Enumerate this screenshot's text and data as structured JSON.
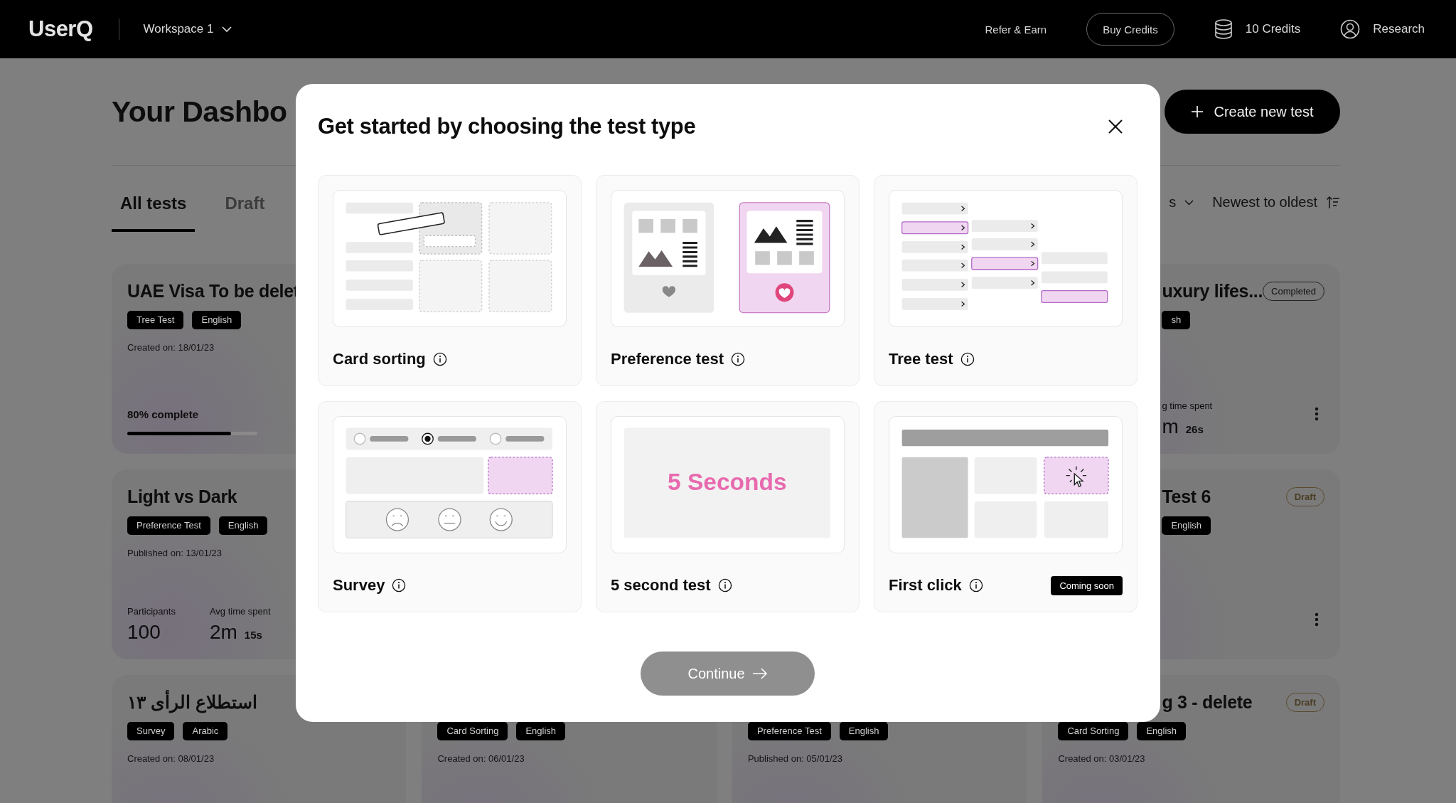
{
  "topbar": {
    "logo": "UserQ",
    "workspace": "Workspace 1",
    "refer": "Refer & Earn",
    "buy_credits": "Buy Credits",
    "credits": "10 Credits",
    "account": "Research"
  },
  "dashboard": {
    "title": "Your Dashbo",
    "create_button": "Create new test",
    "tabs": [
      {
        "label": "All tests",
        "selected": true
      },
      {
        "label": "Draft",
        "selected": false
      }
    ],
    "filter": "s",
    "sort": "Newest to oldest",
    "columns": [
      {
        "cards": [
          {
            "title": "UAE Visa To be delet",
            "tags": [
              "Tree Test",
              "English"
            ],
            "date": "Created on: 18/01/23",
            "progress_label": "80% complete",
            "level": 0.8
          },
          {
            "title": "Light vs Dark",
            "tags": [
              "Preference Test",
              "English"
            ],
            "date": "Published on: 13/01/23",
            "stats": [
              {
                "label": "Participants",
                "value": "100"
              },
              {
                "label": "Avg time spent",
                "value": "2m",
                "unit": "15s"
              }
            ]
          },
          {
            "title": "استطلاع الرأى ١٣",
            "tags": [
              "Survey",
              "Arabic"
            ],
            "date": "Created on: 08/01/23"
          }
        ]
      },
      {
        "cards": [
          {
            "tags": [
              "Card Sorting",
              "English"
            ],
            "date": "Created on: 06/01/23"
          }
        ]
      },
      {
        "cards": [
          {
            "tags": [
              "Preference Test",
              "English"
            ],
            "date": "Published on: 05/01/23"
          }
        ]
      },
      {
        "cards": [
          {
            "title": "uxury lifes...",
            "status": {
              "label": "Completed",
              "kind": "completed"
            },
            "tags": [
              "sh"
            ],
            "stats": [
              {
                "label": "g time spent",
                "value": "m",
                "unit": "26s"
              }
            ],
            "menu": true
          },
          {
            "title": "Test 6",
            "status": {
              "label": "Draft",
              "kind": "draft"
            },
            "tags": [
              "English"
            ],
            "menu": true
          },
          {
            "title": "g 3 - delete",
            "status": {
              "label": "Draft",
              "kind": "draft"
            },
            "tags": [
              "Card Sorting",
              "English"
            ],
            "date": "Created on: 03/01/23"
          }
        ]
      }
    ]
  },
  "modal": {
    "title": "Get started by choosing the test type",
    "options": [
      {
        "kind": "card_sorting",
        "label": "Card sorting",
        "selected": false
      },
      {
        "kind": "preference",
        "label": "Preference test",
        "selected": false
      },
      {
        "kind": "tree",
        "label": "Tree test",
        "selected": false
      },
      {
        "kind": "survey",
        "label": "Survey",
        "selected": false
      },
      {
        "kind": "five_seconds",
        "label": "5 second test",
        "illustration_text": "5 Seconds",
        "selected": false
      },
      {
        "kind": "first_click",
        "label": "First click",
        "badge": "Coming soon",
        "selected": false
      }
    ],
    "continue": {
      "label": "Continue",
      "disabled": true
    }
  }
}
